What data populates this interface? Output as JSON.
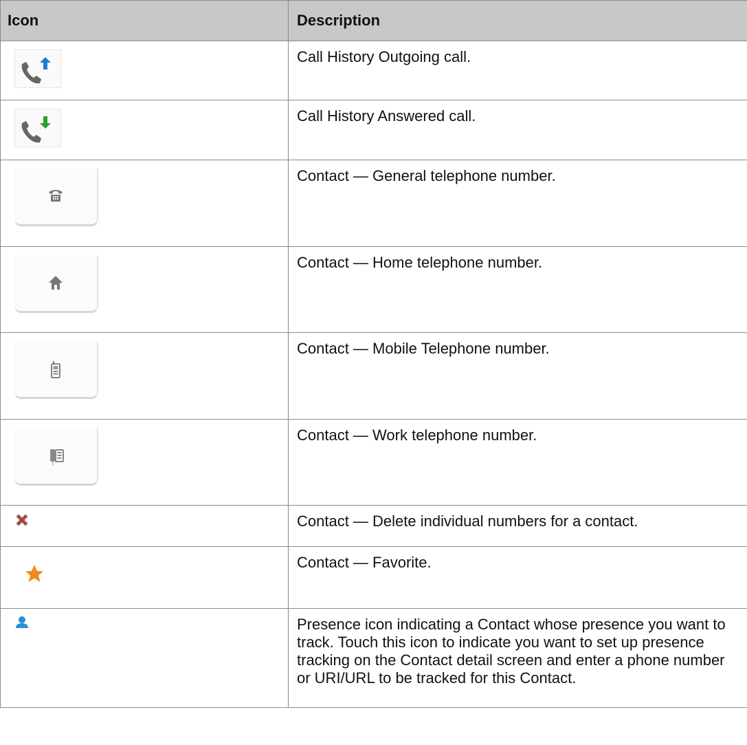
{
  "header": {
    "col_icon": "Icon",
    "col_description": "Description"
  },
  "rows": [
    {
      "icon": "outgoing-call-icon",
      "description": "Call History Outgoing call."
    },
    {
      "icon": "answered-call-icon",
      "description": "Call History Answered call."
    },
    {
      "icon": "general-telephone-icon",
      "description": "Contact — General telephone number."
    },
    {
      "icon": "home-telephone-icon",
      "description": "Contact — Home telephone number."
    },
    {
      "icon": "mobile-telephone-icon",
      "description": "Contact — Mobile Telephone number."
    },
    {
      "icon": "work-telephone-icon",
      "description": "Contact — Work telephone number."
    },
    {
      "icon": "delete-icon",
      "description": "Contact — Delete individual numbers for a contact."
    },
    {
      "icon": "favorite-star-icon",
      "description": "Contact — Favorite."
    },
    {
      "icon": "presence-person-icon",
      "description": "Presence icon indicating a Contact whose presence you want to track. Touch this icon to indicate you want to set up presence tracking on the Contact detail screen and enter a phone number or URI/URL to be tracked for this Contact."
    }
  ],
  "colors": {
    "header_bg": "#c8c8c8",
    "outgoing_arrow": "#1a7fd6",
    "answered_arrow": "#2ca12c",
    "delete_x": "#c0392b",
    "star": "#f08a1c",
    "presence": "#2b8fd6"
  }
}
